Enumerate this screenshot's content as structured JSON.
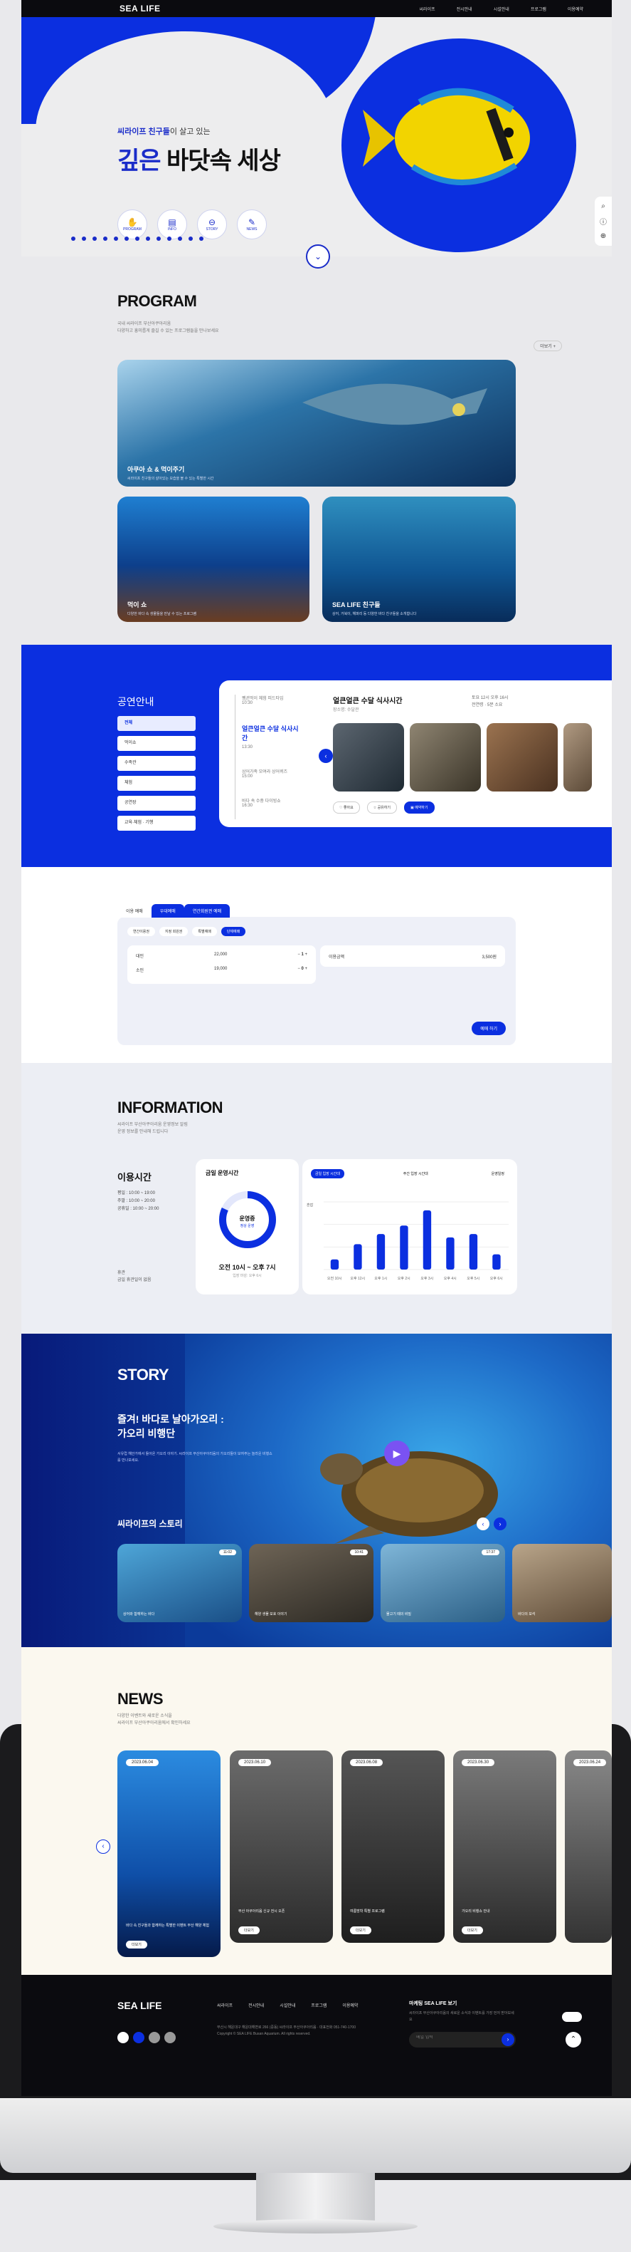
{
  "header": {
    "logo": "SEA LIFE",
    "nav": [
      "씨라이프",
      "전시안내",
      "시설안내",
      "프로그램",
      "이용예약"
    ]
  },
  "hero": {
    "subtitle_blue": "씨라이프 친구들",
    "subtitle_rest": "이 살고 있는",
    "title_blue": "깊은",
    "title_black": "바닷속 세상",
    "icons": [
      {
        "icon": "hand-icon",
        "label": "PROGRAM"
      },
      {
        "icon": "info-icon",
        "label": "INFO"
      },
      {
        "icon": "story-icon",
        "label": "STORY"
      },
      {
        "icon": "news-icon",
        "label": "NEWS"
      }
    ],
    "side_tools": [
      "search-icon",
      "info-circle-icon",
      "globe-icon"
    ]
  },
  "program": {
    "title": "PROGRAM",
    "desc1": "국내 씨라이프 부산아쿠아리움",
    "desc2": "다양하고 흥미롭게 즐길 수 있는 프로그램들을 만나보세요",
    "more": "더보기 +",
    "cards": [
      {
        "label": "아쿠아 쇼 & 먹이주기",
        "desc": "씨라이프 친구들의 살아있는 모습을 볼 수 있는 특별한 시간"
      },
      {
        "label": "먹이 쇼",
        "desc": "다양한 바다 속 생물들을 만날 수 있는 프로그램"
      },
      {
        "label": "SEA LIFE 친구들",
        "desc": "상어, 거북이, 해파리 등 다양한 바다 친구들을 소개합니다"
      }
    ]
  },
  "performance": {
    "title": "공연안내",
    "menu": [
      "전체",
      "먹이쇼",
      "수족관",
      "체험",
      "공연장",
      "교육·체험 · 기행"
    ],
    "timeline": [
      {
        "title": "펭귄먹이 체험 피드타임",
        "time": "10:30"
      },
      {
        "title": "얼큰얼큰 수달 식사시간",
        "time": "13:30"
      },
      {
        "title": "상어가족 모여라 상어퀴즈",
        "time": "15:00"
      },
      {
        "title": "바다 속 수중 다이빙쇼",
        "time": "16:30"
      }
    ],
    "detail_title": "얼큰얼큰 수달 식사시간",
    "detail_sub": "장소명: 수달관",
    "meta1": "토요 12시 오후 16시",
    "meta2": "전연령 · 5분 소요",
    "buttons": [
      "좋아요",
      "공유하기",
      "예약하기"
    ]
  },
  "booking": {
    "tabs": [
      "이용 예매",
      "우대예매",
      "연간회원권 예매"
    ],
    "subtabs": [
      "연간이용권",
      "지정 회원권",
      "특별예매",
      "단체예매"
    ],
    "adult_label": "대인",
    "adult_price": "22,000",
    "adult_qty": "1",
    "child_label": "소인",
    "child_price": "19,000",
    "child_qty": "0",
    "total_label": "이용금액",
    "total_value": "3,500원",
    "submit": "예매 하기"
  },
  "information": {
    "title": "INFORMATION",
    "desc1": "씨라이프 부산아쿠아리움 운영정보 알림",
    "desc2": "운영 정보를 안내해 드립니다",
    "hours_title": "이용시간",
    "hours": [
      "평일 : 10:00 ~ 19:00",
      "주말 : 10:00 ~ 20:00",
      "공휴일 : 10:00 ~ 20:00"
    ],
    "note": "휴관",
    "note2": "금일 휴관일이 없음",
    "today_title": "금일 운영시간",
    "status": "운영중",
    "status_sub": "정상 운영",
    "today_hours": "오전 10시 ~ 오후 7시",
    "today_note": "입장 마감: 오후 6시",
    "chart_tabs": [
      "금일 입장 시간대",
      "주간 입장 시간대",
      "운영일정"
    ],
    "chart_label": "혼잡"
  },
  "chart_data": {
    "type": "bar",
    "categories": [
      "오전 10시",
      "오후 12시",
      "오후 1시",
      "오후 2시",
      "오후 3시",
      "오후 4시",
      "오후 5시",
      "오후 6시"
    ],
    "values": [
      12,
      30,
      42,
      52,
      70,
      38,
      42,
      18
    ],
    "title": "",
    "xlabel": "",
    "ylabel": ""
  },
  "story": {
    "title": "STORY",
    "headline1": "즐겨! 바다로 날아가오리 :",
    "headline2": "가오리 비행단",
    "desc": "서유럽 해안가에서 돌아온 가오리 이야기. 씨라이프 부산아쿠아리움의 가오리들이 보여주는 놀라운 비행쇼를 만나보세요.",
    "subtitle": "씨라이프의 스토리",
    "cards": [
      {
        "time": "11:02",
        "text": "상어와 함께하는 바다"
      },
      {
        "time": "10:41",
        "text": "해양 생물 보호 이야기"
      },
      {
        "time": "17:37",
        "text": "물고기 떼의 비밀"
      },
      {
        "time": "",
        "text": "바다의 보석"
      }
    ]
  },
  "news": {
    "title": "NEWS",
    "desc1": "다양한 이벤트와 새로운 소식을",
    "desc2": "씨라이프 부산아쿠아리움에서 확인하세요",
    "cards": [
      {
        "date": "2023.06.04",
        "text": "바다 속 친구들과 함께하는 특별한 이벤트 부산 해양 체험",
        "btn": "더보기"
      },
      {
        "date": "2023.06.10",
        "text": "부산 아쿠아리움 신규 전시 오픈",
        "btn": "더보기"
      },
      {
        "date": "2023.06.08",
        "text": "여름방학 특별 프로그램",
        "btn": "더보기"
      },
      {
        "date": "2023.06.30",
        "text": "가오리 비행쇼 안내",
        "btn": "더보기"
      },
      {
        "date": "2023.06.24",
        "text": "부산 해양 축제",
        "btn": "더보기"
      }
    ]
  },
  "footer": {
    "logo": "SEA LIFE",
    "nav": [
      "씨라이프",
      "전시안내",
      "시설안내",
      "프로그램",
      "이용예약"
    ],
    "address": "부산시 해운대구 해운대해변로 266 (중동) 씨라이프 부산아쿠아리움 · 대표전화 051-740-1700",
    "copyright": "Copyright © SEA LIFE Busan Aquarium. All rights reserved.",
    "newsletter_title": "마케팅 SEA LIFE 보기",
    "newsletter_desc": "씨라이프 부산아쿠아리움의 새로운 소식과 이벤트를 가장 먼저 받아보세요",
    "input_placeholder": "메일 입력",
    "colors": {
      "accent": "#0b2fe0",
      "dark": "#0b0b0f"
    }
  }
}
